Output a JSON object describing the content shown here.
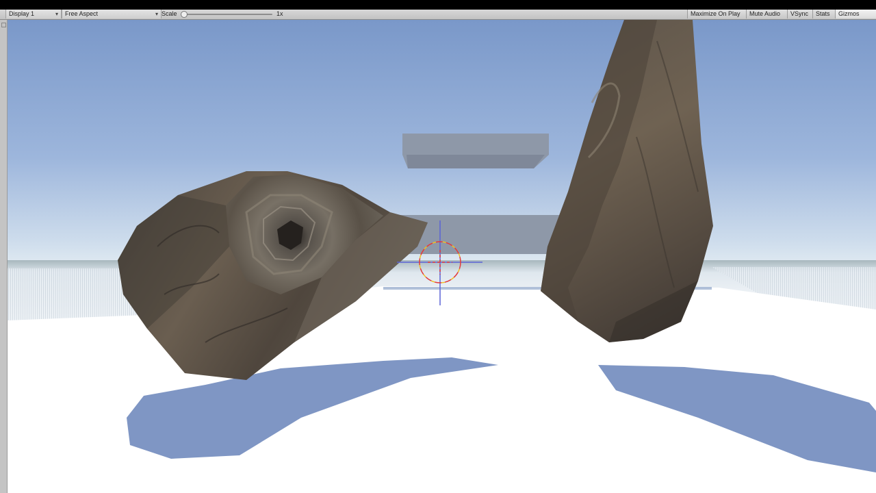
{
  "toolbar": {
    "display": "Display 1",
    "aspect": "Free Aspect",
    "scale_label": "Scale",
    "scale_value": "1x",
    "maximize_on_play": "Maximize On Play",
    "mute_audio": "Mute Audio",
    "vsync": "VSync",
    "stats": "Stats",
    "gizmos": "Gizmos"
  },
  "icons": {
    "dropdown": "chevron-down-icon",
    "crosshair": "crosshair-icon"
  },
  "colors": {
    "sky_top": "#7a98c9",
    "sky_horizon": "#dbe8f2",
    "ground": "#ffffff",
    "shadow": "#7f96c4",
    "platform": "#8e98a8",
    "rock": "#5b5147"
  }
}
